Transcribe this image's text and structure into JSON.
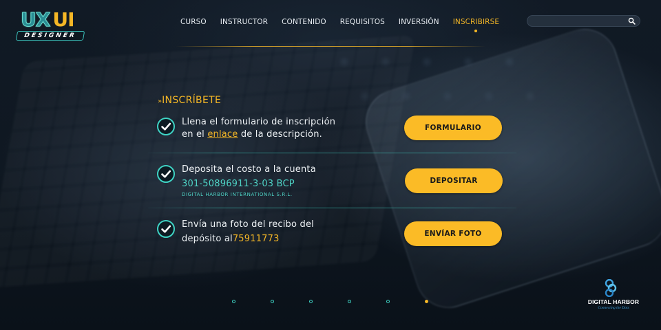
{
  "logo": {
    "ux": "UX",
    "ui": "UI",
    "subtitle": "DESIGNER"
  },
  "nav": {
    "items": [
      "CURSO",
      "INSTRUCTOR",
      "CONTENIDO",
      "REQUISITOS",
      "INVERSIÓN",
      "INSCRIBIRSE"
    ],
    "active": "INSCRIBIRSE"
  },
  "search": {
    "value": "",
    "placeholder": ""
  },
  "section": {
    "chevrons": "»",
    "title": "INSCRÍBETE"
  },
  "steps": [
    {
      "line1": "Llena el formulario de inscripción",
      "line2_pre": "en el ",
      "line2_link": "enlace",
      "line2_post": " de la descripción.",
      "button": "FORMULARIO"
    },
    {
      "line1": "Deposita el costo a la cuenta",
      "account": "301-50896911-3-03 BCP",
      "holder": "DIGITAL HARBOR INTERNATIONAL S.R.L.",
      "button": "DEPOSITAR"
    },
    {
      "line1": "Envía una foto del recibo del",
      "line2_pre": "depósito al ",
      "line2_hl": "75911773",
      "button": "ENVÍAR FOTO"
    }
  ],
  "pagination": {
    "count": 6,
    "active_index": 5
  },
  "brand": {
    "name": "DIGITAL HARBOR",
    "tagline": "Connecting the Dots"
  },
  "colors": {
    "accent": "#f5b726",
    "button": "#fbbb26",
    "teal": "#3ed3c4",
    "background": "#0d1520"
  }
}
